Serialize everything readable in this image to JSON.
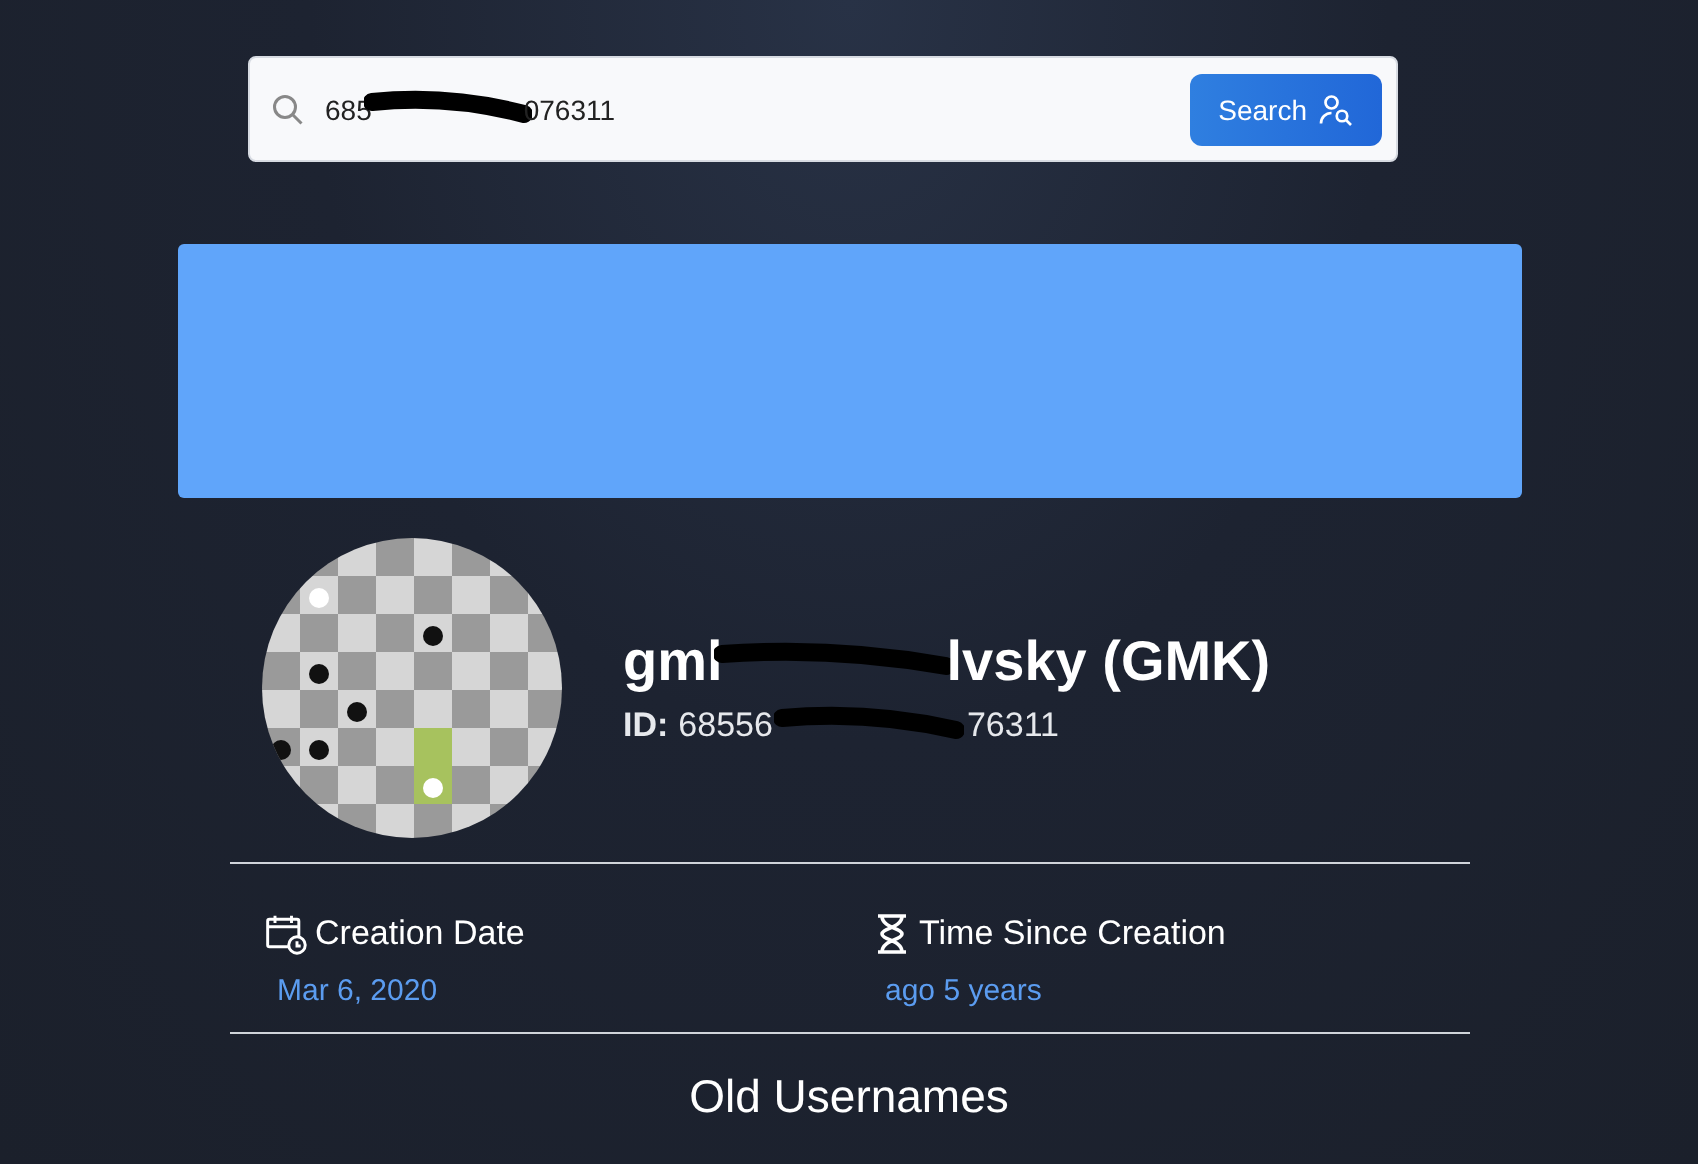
{
  "search": {
    "value_start": "685",
    "value_end": "076311",
    "button": "Search"
  },
  "banner": {
    "kind": "plain"
  },
  "profile": {
    "name_start": "gml",
    "name_end": "lvsky (GMK)",
    "id_label": "ID:",
    "id_start": "68556",
    "id_end": "76311"
  },
  "stats": [
    {
      "kind": "calendar",
      "label": "Creation Date",
      "value": "Mar 6, 2020"
    },
    {
      "kind": "hourglass",
      "label": "Time Since Creation",
      "value": "ago 5 years"
    }
  ],
  "section_title": "Old Usernames"
}
